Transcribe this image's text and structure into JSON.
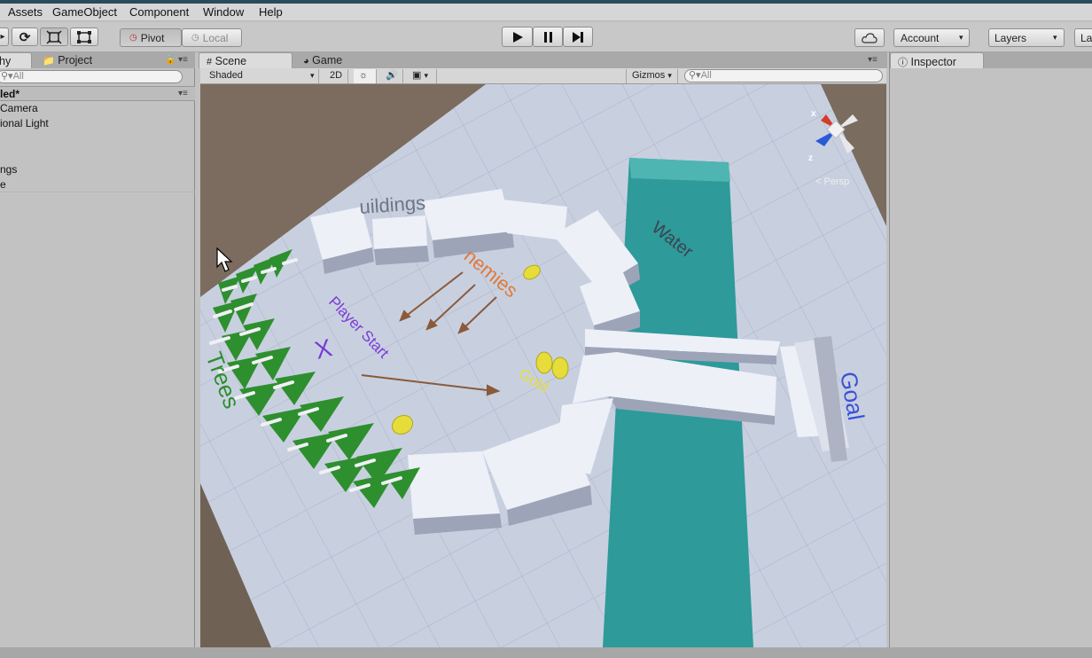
{
  "menu": [
    "Assets",
    "GameObject",
    "Component",
    "Window",
    "Help"
  ],
  "toolbar": {
    "pivot": "Pivot",
    "local": "Local",
    "account": "Account",
    "layers": "Layers",
    "layout_partial": "La"
  },
  "hierarchy": {
    "tab_label": "hy",
    "project_tab": "Project",
    "search_placeholder": "All",
    "scene_name": "led*",
    "items": [
      "Camera",
      "ional Light",
      "ngs",
      "e"
    ]
  },
  "scene": {
    "scene_tab": "Scene",
    "game_tab": "Game",
    "shading_mode": "Shaded",
    "mode_2d": "2D",
    "gizmos": "Gizmos",
    "search_placeholder": "All",
    "persp": "Persp",
    "axis_x": "x",
    "axis_z": "z",
    "labels": {
      "buildings": "uildings",
      "enemies": "nemies",
      "player_start": "Player Start",
      "x_mark": "X",
      "gold": "Gold",
      "trees": "Trees",
      "water": "Water",
      "goal": "Goal"
    }
  },
  "inspector": {
    "tab_label": "Inspector"
  },
  "colors": {
    "water": "#2e9a9a",
    "player_start": "#7a3ad6",
    "enemies": "#e07a3a",
    "goal": "#3a52d6",
    "trees": "#2e8f2e",
    "gold": "#e0d83a"
  }
}
